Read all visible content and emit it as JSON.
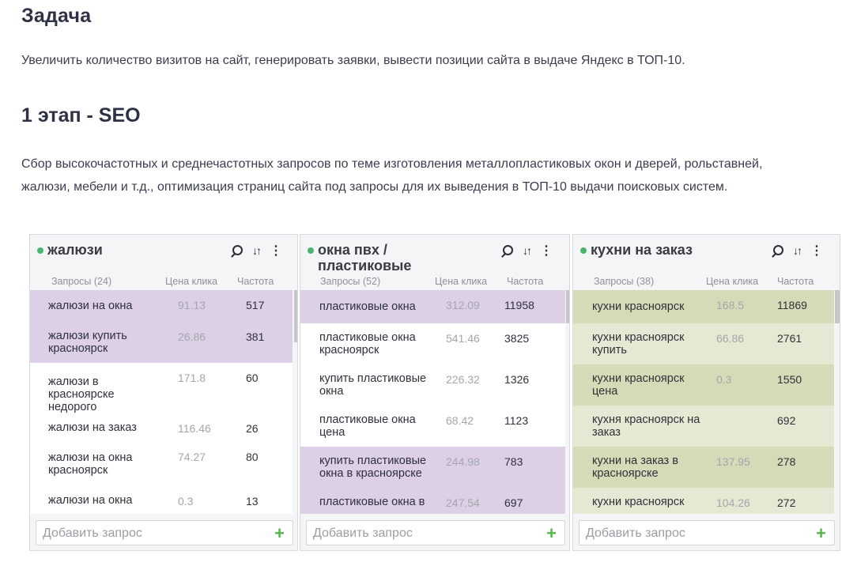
{
  "task": {
    "title": "Задача",
    "text": "Увеличить количество визитов на сайт, генерировать заявки, вывести позиции сайта в выдаче Яндекс в ТОП-10."
  },
  "stage": {
    "title": "1 этап - SEO",
    "text": "Сбор высокочастотных и среднечастотных запросов по теме изготовления металлопластиковых окон и дверей, рольставней, жалюзи, мебели и т.д., оптимизация страниц сайта под запросы для их выведения в ТОП-10 выдачи поисковых систем."
  },
  "colors": {
    "accent_green": "#4bb56f",
    "plus_green": "#53b74a",
    "purple_row": "#dccfe6",
    "olive_row": "#d3dcb7",
    "light_olive_row": "#e3e9d2"
  },
  "panels": [
    {
      "title": "жалюзи",
      "col_query": "Запросы (24)",
      "col_price": "Цена клика",
      "col_freq": "Частота",
      "add_placeholder": "Добавить запрос",
      "rows": [
        {
          "query": "жалюзи на окна",
          "price": "91.13",
          "freq": "517",
          "highlight": "purple"
        },
        {
          "query": "жалюзи купить красноярск",
          "price": "26.86",
          "freq": "381",
          "highlight": "purple"
        },
        {
          "query": "жалюзи в красноярске недорого",
          "price": "171.8",
          "freq": "60",
          "highlight": "none"
        },
        {
          "query": "жалюзи на заказ",
          "price": "116.46",
          "freq": "26",
          "highlight": "none"
        },
        {
          "query": "жалюзи на окна красноярск",
          "price": "74.27",
          "freq": "80",
          "highlight": "none"
        },
        {
          "query": "жалюзи на окна",
          "price": "0.3",
          "freq": "13",
          "highlight": "none"
        }
      ]
    },
    {
      "title": "окна пвх / пластиковые",
      "col_query": "Запросы (52)",
      "col_price": "Цена клика",
      "col_freq": "Частота",
      "add_placeholder": "Добавить запрос",
      "rows": [
        {
          "query": "пластиковые окна",
          "price": "312.09",
          "freq": "11958",
          "highlight": "purple"
        },
        {
          "query": "пластиковые окна красноярск",
          "price": "541.46",
          "freq": "3825",
          "highlight": "none"
        },
        {
          "query": "купить пластиковые окна",
          "price": "226.32",
          "freq": "1326",
          "highlight": "none"
        },
        {
          "query": "пластиковые окна цена",
          "price": "68.42",
          "freq": "1123",
          "highlight": "none"
        },
        {
          "query": "купить пластиковые окна в красноярске",
          "price": "244.98",
          "freq": "783",
          "highlight": "purple"
        },
        {
          "query": "пластиковые окна в",
          "price": "247.54",
          "freq": "697",
          "highlight": "purple"
        }
      ]
    },
    {
      "title": "кухни на заказ",
      "col_query": "Запросы (38)",
      "col_price": "Цена клика",
      "col_freq": "Частота",
      "add_placeholder": "Добавить запрос",
      "rows": [
        {
          "query": "кухни красноярск",
          "price": "168.5",
          "freq": "11869",
          "highlight": "olive"
        },
        {
          "query": "кухни красноярск купить",
          "price": "66.86",
          "freq": "2761",
          "highlight": "light"
        },
        {
          "query": "кухни красноярск цена",
          "price": "0.3",
          "freq": "1550",
          "highlight": "olive"
        },
        {
          "query": "кухня красноярск на заказ",
          "price": "",
          "freq": "692",
          "highlight": "light"
        },
        {
          "query": "кухни на заказ в красноярске",
          "price": "137.95",
          "freq": "278",
          "highlight": "olive"
        },
        {
          "query": "кухни красноярск",
          "price": "104.26",
          "freq": "272",
          "highlight": "light"
        }
      ]
    }
  ]
}
